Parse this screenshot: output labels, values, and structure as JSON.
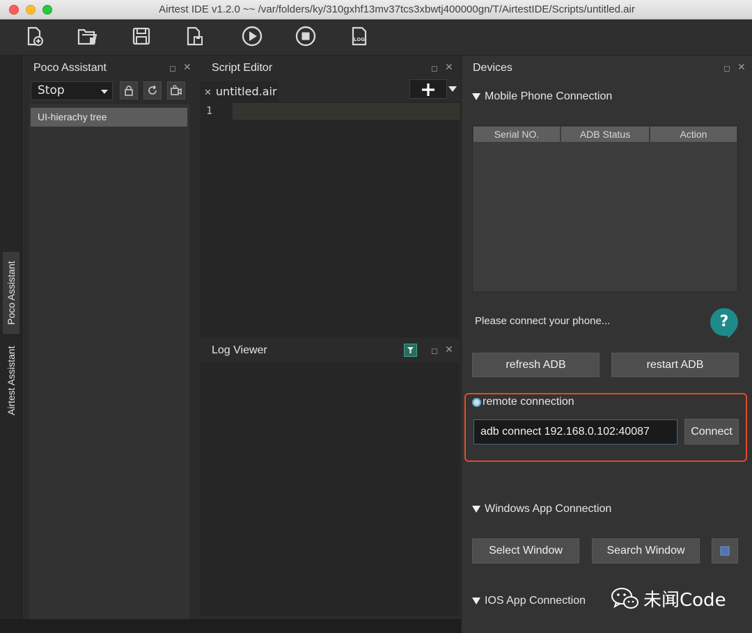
{
  "window": {
    "title": "Airtest IDE v1.2.0 ~~ /var/folders/ky/310gxhf13mv37tcs3xbwtj400000gn/T/AirtestIDE/Scripts/untitled.air"
  },
  "toolbar": {
    "icons": [
      "new-file-icon",
      "open-folder-icon",
      "save-icon",
      "save-as-icon",
      "run-icon",
      "stop-icon",
      "log-icon"
    ],
    "log_label": "LOG"
  },
  "vertical_tabs": {
    "poco": "Poco Assistant",
    "airtest": "Airtest Assistant"
  },
  "poco": {
    "title": "Poco Assistant",
    "mode_value": "Stop",
    "tree_item": "UI-hierachy tree"
  },
  "script_editor": {
    "title": "Script Editor",
    "tab_label": "untitled.air",
    "line_number": "1"
  },
  "log_viewer": {
    "title": "Log Viewer"
  },
  "devices": {
    "title": "Devices",
    "mobile_section": "Mobile Phone Connection",
    "table_headers": [
      "Serial NO.",
      "ADB Status",
      "Action"
    ],
    "status_text": "Please connect your phone...",
    "help_label": "?",
    "refresh_label": "refresh ADB",
    "restart_label": "restart ADB",
    "remote_label": "remote connection",
    "adb_value": "adb connect 192.168.0.102:40087",
    "connect_label": "Connect",
    "windows_section": "Windows App Connection",
    "select_window_label": "Select Window",
    "search_window_label": "Search Window",
    "ios_section": "IOS App Connection"
  },
  "watermark": {
    "text": "未闻Code"
  },
  "colors": {
    "accent_teal": "#1f8a8a",
    "highlight_red": "#e24a2a"
  }
}
